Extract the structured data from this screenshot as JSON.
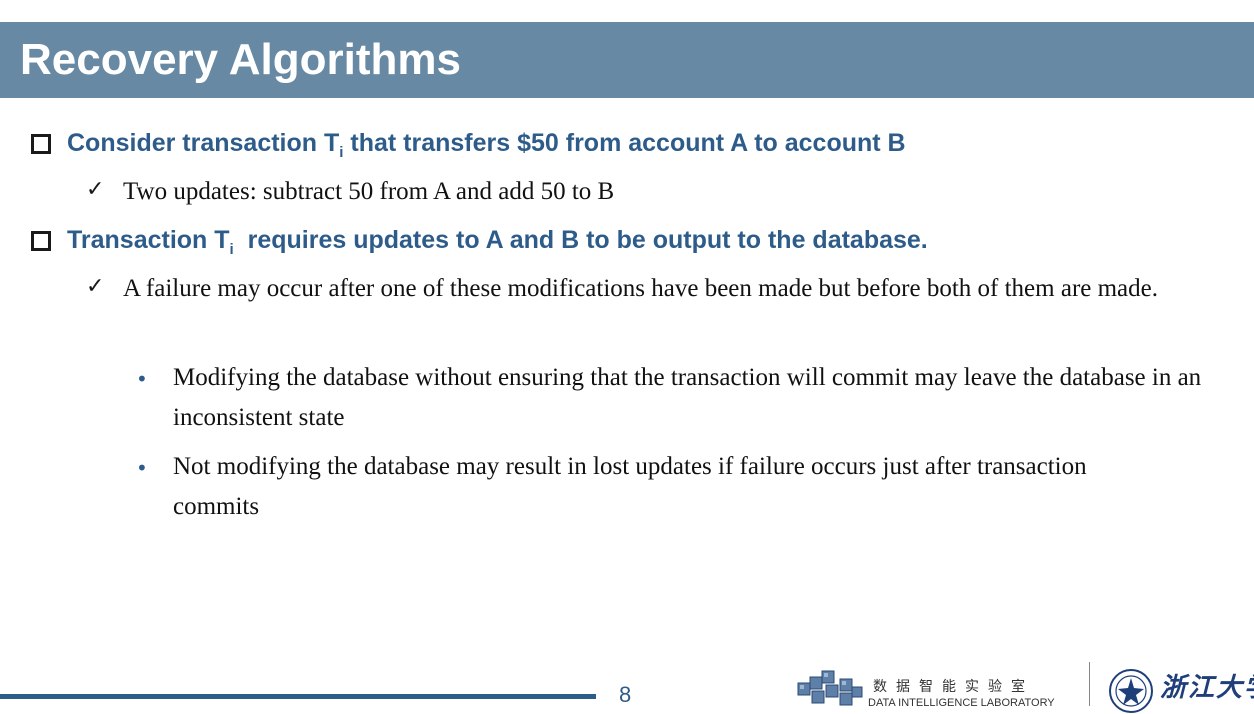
{
  "slide": {
    "title": "Recovery Algorithms",
    "page_number": "8"
  },
  "bullets": [
    {
      "text_before": "Consider transaction T",
      "subscript": "i",
      "text_after": " that transfers $50 from account A to account B",
      "sub_items": [
        {
          "text": "Two updates: subtract 50 from A and add 50 to B"
        }
      ]
    },
    {
      "text_before": "Transaction T",
      "subscript": "i",
      "text_after": "  requires updates to A and B to be output to the database.",
      "sub_items": [
        {
          "text": "A failure may occur after one of these modifications have been made but before both of them are made.",
          "sub_items": [
            {
              "text": "Modifying the database without ensuring that the transaction will commit may leave the database in an inconsistent state"
            },
            {
              "text": "Not modifying the database may result in lost updates if failure occurs just after transaction commits"
            }
          ]
        }
      ]
    }
  ],
  "footer": {
    "lab_name_cn": "数据智能实验室",
    "lab_name_en": "DATA INTELLIGENCE LABORATORY",
    "university_cn": "浙江大学"
  },
  "colors": {
    "title_bar": "#6889a4",
    "heading_blue": "#2e5c8a",
    "body_text": "#111111"
  },
  "icons": {
    "level1_bullet": "hollow-square",
    "level2_bullet": "check-mark",
    "level3_bullet": "round-dot"
  }
}
